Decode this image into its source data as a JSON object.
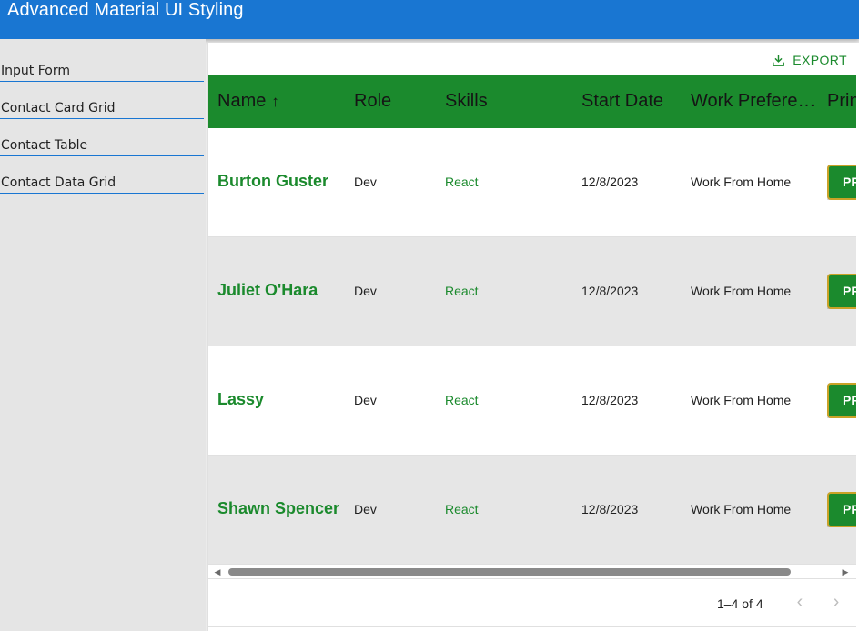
{
  "app": {
    "title": "Advanced Material UI Styling"
  },
  "sidebar": {
    "items": [
      {
        "label": "Input Form"
      },
      {
        "label": "Contact Card Grid"
      },
      {
        "label": "Contact Table"
      },
      {
        "label": "Contact Data Grid"
      }
    ]
  },
  "toolbar": {
    "export_label": "EXPORT",
    "export_icon": "download-icon"
  },
  "grid": {
    "columns": [
      {
        "label": "Name",
        "sort": "↑"
      },
      {
        "label": "Role"
      },
      {
        "label": "Skills"
      },
      {
        "label": "Start Date"
      },
      {
        "label": "Work Preference"
      },
      {
        "label": "Print"
      }
    ],
    "rows": [
      {
        "name": "Burton Guster",
        "role": "Dev",
        "skills": "React",
        "start_date": "12/8/2023",
        "work_pref": "Work From Home",
        "print": "PRINT"
      },
      {
        "name": "Juliet O'Hara",
        "role": "Dev",
        "skills": "React",
        "start_date": "12/8/2023",
        "work_pref": "Work From Home",
        "print": "PRINT"
      },
      {
        "name": "Lassy",
        "role": "Dev",
        "skills": "React",
        "start_date": "12/8/2023",
        "work_pref": "Work From Home",
        "print": "PRINT"
      },
      {
        "name": "Shawn Spencer",
        "role": "Dev",
        "skills": "React",
        "start_date": "12/8/2023",
        "work_pref": "Work From Home",
        "print": "PRINT"
      }
    ]
  },
  "pagination": {
    "text": "1–4 of 4",
    "prev_icon": "chevron-left-icon",
    "next_icon": "chevron-right-icon"
  },
  "colors": {
    "appbar": "#1976d2",
    "accent_green": "#1b8a2d",
    "button_border": "#c9a227"
  }
}
